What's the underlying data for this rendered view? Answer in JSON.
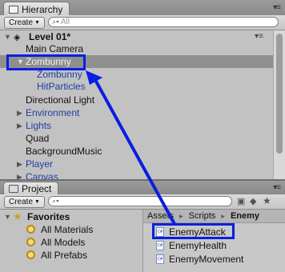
{
  "hierarchy": {
    "tab_label": "Hierarchy",
    "create_label": "Create",
    "search_placeholder": "All",
    "scene_name": "Level 01*",
    "items": [
      {
        "label": "Main Camera"
      },
      {
        "label": "Zombunny"
      },
      {
        "label": "Zombunny"
      },
      {
        "label": "HitParticles"
      },
      {
        "label": "Directional Light"
      },
      {
        "label": "Environment"
      },
      {
        "label": "Lights"
      },
      {
        "label": "Quad"
      },
      {
        "label": "BackgroundMusic"
      },
      {
        "label": "Player"
      },
      {
        "label": "Canvas"
      }
    ]
  },
  "project": {
    "tab_label": "Project",
    "create_label": "Create",
    "favorites": {
      "header": "Favorites",
      "items": [
        {
          "label": "All Materials"
        },
        {
          "label": "All Models"
        },
        {
          "label": "All Prefabs"
        }
      ]
    },
    "breadcrumb": {
      "assets": "Assets",
      "scripts": "Scripts",
      "enemy": "Enemy",
      "separator": "▸"
    },
    "files": [
      {
        "label": "EnemyAttack",
        "icon_text": "C#"
      },
      {
        "label": "EnemyHealth",
        "icon_text": "C#"
      },
      {
        "label": "EnemyMovement",
        "icon_text": "C#"
      }
    ]
  },
  "annotation": {
    "color": "#0a1fe0"
  }
}
